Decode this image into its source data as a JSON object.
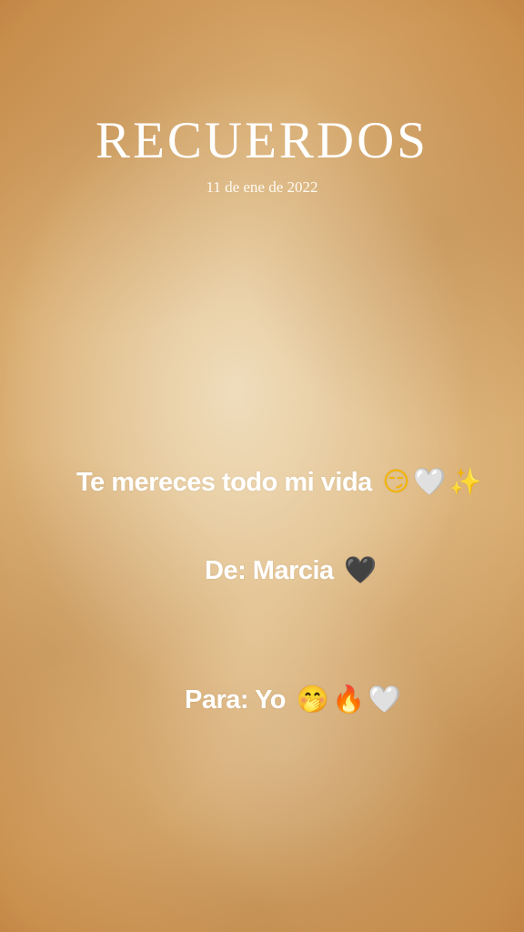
{
  "header": {
    "title": "RECUERDOS",
    "date": "11 de ene de 2022"
  },
  "messages": {
    "line1": {
      "text": "Te mereces todo mi vida",
      "emojis": [
        "😏",
        "🤍",
        "✨"
      ]
    },
    "line2": {
      "text": "De: Marcia",
      "emojis": [
        "🖤"
      ]
    },
    "line3": {
      "text": "Para: Yo",
      "emojis": [
        "🤭",
        "🔥",
        "🤍"
      ]
    }
  },
  "colors": {
    "background_center": "#efdcbc",
    "background_edge": "#c98f4d",
    "text": "#ffffff"
  }
}
